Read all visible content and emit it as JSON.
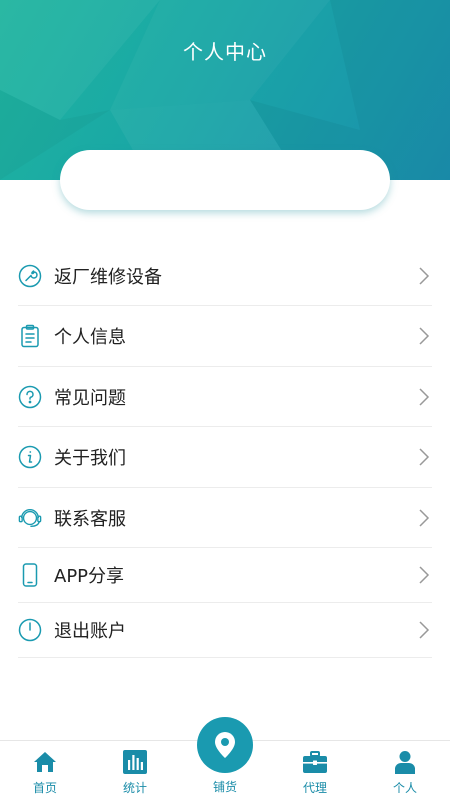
{
  "header": {
    "title": "个人中心"
  },
  "menu": [
    {
      "label": "返厂维修设备",
      "icon": "wrench-icon"
    },
    {
      "label": "个人信息",
      "icon": "clipboard-icon"
    },
    {
      "label": "常见问题",
      "icon": "question-icon"
    },
    {
      "label": "关于我们",
      "icon": "info-icon"
    },
    {
      "label": "联系客服",
      "icon": "headset-icon"
    },
    {
      "label": "APP分享",
      "icon": "phone-icon"
    },
    {
      "label": "退出账户",
      "icon": "power-icon"
    }
  ],
  "tabs": [
    {
      "label": "首页",
      "icon": "home-icon"
    },
    {
      "label": "统计",
      "icon": "chart-icon"
    },
    {
      "label": "铺货",
      "icon": "location-pin-icon"
    },
    {
      "label": "代理",
      "icon": "briefcase-icon"
    },
    {
      "label": "个人",
      "icon": "person-icon"
    }
  ],
  "colors": {
    "accent": "#1a9ab0",
    "header_start": "#1fb59f",
    "header_end": "#1b8fae"
  }
}
